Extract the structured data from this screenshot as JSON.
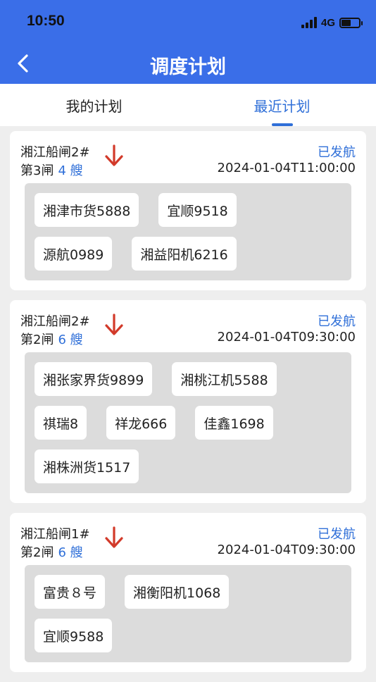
{
  "status_bar": {
    "time": "10:50",
    "network": "4G"
  },
  "header": {
    "title": "调度计划"
  },
  "tabs": [
    {
      "label": "我的计划",
      "active": false
    },
    {
      "label": "最近计划",
      "active": true
    }
  ],
  "plans": [
    {
      "lock_name": "湘江船闸2#",
      "chamber": "第3闸",
      "ship_count": "4 艘",
      "status": "已发航",
      "time": "2024-01-04T11:00:00",
      "ships": [
        "湘津市货5888",
        "宜顺9518",
        "源航0989",
        "湘益阳机6216"
      ]
    },
    {
      "lock_name": "湘江船闸2#",
      "chamber": "第2闸",
      "ship_count": "6 艘",
      "status": "已发航",
      "time": "2024-01-04T09:30:00",
      "ships": [
        "湘张家界货9899",
        "湘桃江机5588",
        "祺瑞8",
        "祥龙666",
        "佳鑫1698",
        "湘株洲货1517"
      ]
    },
    {
      "lock_name": "湘江船闸1#",
      "chamber": "第2闸",
      "ship_count": "6 艘",
      "status": "已发航",
      "time": "2024-01-04T09:30:00",
      "ships": [
        "富贵８号",
        "湘衡阳机1068",
        "宜顺9588"
      ]
    }
  ],
  "colors": {
    "header": "#3a6ee8",
    "accent": "#2f6fd8",
    "arrow": "#d23a2a"
  }
}
